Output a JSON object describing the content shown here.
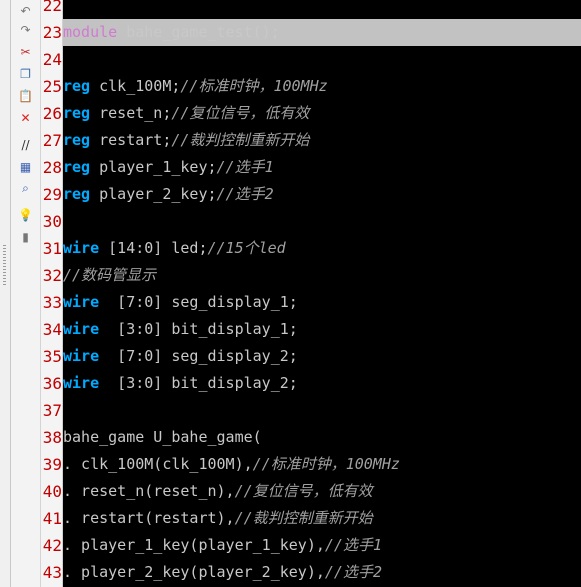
{
  "icons": [
    "undo-icon",
    "redo-icon",
    "cut-icon",
    "copy-icon",
    "paste-icon",
    "delete-icon",
    "comment-icon",
    "select-all-icon",
    "find-icon",
    "hint-icon",
    "bookmark-icon"
  ],
  "lines": [
    {
      "num": "22",
      "tokens": []
    },
    {
      "num": "23",
      "highlight": true,
      "tokens": [
        {
          "t": "module",
          "c": "kwp"
        },
        {
          "t": " bahe_game_test();",
          "c": "tx"
        }
      ]
    },
    {
      "num": "24",
      "tokens": []
    },
    {
      "num": "25",
      "tokens": [
        {
          "t": "reg",
          "c": "kw"
        },
        {
          "t": " clk_100M;",
          "c": "tx"
        },
        {
          "t": "//标准时钟，100MHz",
          "c": "cm"
        }
      ]
    },
    {
      "num": "26",
      "tokens": [
        {
          "t": "reg",
          "c": "kw"
        },
        {
          "t": " reset_n;",
          "c": "tx"
        },
        {
          "t": "//复位信号，低有效",
          "c": "cm"
        }
      ]
    },
    {
      "num": "27",
      "tokens": [
        {
          "t": "reg",
          "c": "kw"
        },
        {
          "t": " restart;",
          "c": "tx"
        },
        {
          "t": "//裁判控制重新开始",
          "c": "cm"
        }
      ]
    },
    {
      "num": "28",
      "tokens": [
        {
          "t": "reg",
          "c": "kw"
        },
        {
          "t": " player_1_key;",
          "c": "tx"
        },
        {
          "t": "//选手1",
          "c": "cm"
        }
      ]
    },
    {
      "num": "29",
      "tokens": [
        {
          "t": "reg",
          "c": "kw"
        },
        {
          "t": " player_2_key;",
          "c": "tx"
        },
        {
          "t": "//选手2",
          "c": "cm"
        }
      ]
    },
    {
      "num": "30",
      "tokens": []
    },
    {
      "num": "31",
      "tokens": [
        {
          "t": "wire",
          "c": "kw"
        },
        {
          "t": " [14:0] led;",
          "c": "tx"
        },
        {
          "t": "//15个led",
          "c": "cm"
        }
      ]
    },
    {
      "num": "32",
      "tokens": [
        {
          "t": "//数码管显示",
          "c": "cm"
        }
      ]
    },
    {
      "num": "33",
      "tokens": [
        {
          "t": "wire",
          "c": "kw"
        },
        {
          "t": "  [7:0] seg_display_1;",
          "c": "tx"
        }
      ]
    },
    {
      "num": "34",
      "tokens": [
        {
          "t": "wire",
          "c": "kw"
        },
        {
          "t": "  [3:0] bit_display_1;",
          "c": "tx"
        }
      ]
    },
    {
      "num": "35",
      "tokens": [
        {
          "t": "wire",
          "c": "kw"
        },
        {
          "t": "  [7:0] seg_display_2;",
          "c": "tx"
        }
      ]
    },
    {
      "num": "36",
      "tokens": [
        {
          "t": "wire",
          "c": "kw"
        },
        {
          "t": "  [3:0] bit_display_2;",
          "c": "tx"
        }
      ]
    },
    {
      "num": "37",
      "tokens": []
    },
    {
      "num": "38",
      "tokens": [
        {
          "t": "bahe_game U_bahe_game(",
          "c": "tx"
        }
      ]
    },
    {
      "num": "39",
      "tokens": [
        {
          "t": ". clk_100M(clk_100M),",
          "c": "tx"
        },
        {
          "t": "//标准时钟，100MHz",
          "c": "cm"
        }
      ]
    },
    {
      "num": "40",
      "tokens": [
        {
          "t": ". reset_n(reset_n),",
          "c": "tx"
        },
        {
          "t": "//复位信号，低有效",
          "c": "cm"
        }
      ]
    },
    {
      "num": "41",
      "tokens": [
        {
          "t": ". restart(restart),",
          "c": "tx"
        },
        {
          "t": "//裁判控制重新开始",
          "c": "cm"
        }
      ]
    },
    {
      "num": "42",
      "tokens": [
        {
          "t": ". player_1_key(player_1_key),",
          "c": "tx"
        },
        {
          "t": "//选手1",
          "c": "cm"
        }
      ]
    },
    {
      "num": "43",
      "tokens": [
        {
          "t": ". player_2_key(player_2_key),",
          "c": "tx"
        },
        {
          "t": "//选手2",
          "c": "cm"
        }
      ]
    }
  ]
}
